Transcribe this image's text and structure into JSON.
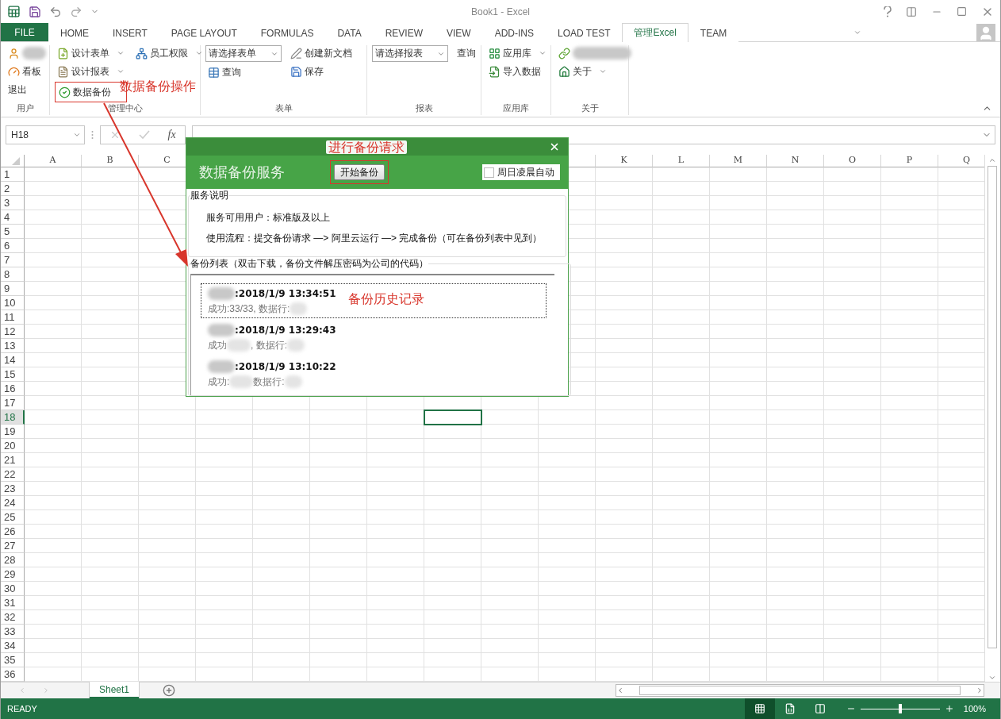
{
  "window": {
    "title": "Book1 - Excel"
  },
  "ribbon_tabs": [
    {
      "label": "FILE",
      "kind": "file",
      "selected": false
    },
    {
      "label": "HOME",
      "kind": "tab",
      "selected": false
    },
    {
      "label": "INSERT",
      "kind": "tab",
      "selected": false
    },
    {
      "label": "PAGE LAYOUT",
      "kind": "tab",
      "selected": false
    },
    {
      "label": "FORMULAS",
      "kind": "tab",
      "selected": false
    },
    {
      "label": "DATA",
      "kind": "tab",
      "selected": false
    },
    {
      "label": "REVIEW",
      "kind": "tab",
      "selected": false
    },
    {
      "label": "VIEW",
      "kind": "tab",
      "selected": false
    },
    {
      "label": "ADD-INS",
      "kind": "tab",
      "selected": false
    },
    {
      "label": "LOAD TEST",
      "kind": "tab",
      "selected": false
    },
    {
      "label": "管理Excel",
      "kind": "tab",
      "selected": true
    },
    {
      "label": "TEAM",
      "kind": "tab",
      "selected": false
    }
  ],
  "ribbon_groups": [
    {
      "label": "用户",
      "columns": [
        [
          {
            "kind": "user"
          },
          {
            "kind": "button",
            "label": "看板"
          },
          {
            "kind": "plain",
            "label": "退出"
          }
        ]
      ]
    },
    {
      "label": "管理中心",
      "columns": [
        [
          {
            "kind": "menu",
            "label": "设计表单"
          },
          {
            "kind": "menu",
            "label": "设计报表"
          },
          {
            "kind": "button",
            "label": "数据备份",
            "boxed": true
          }
        ],
        [
          {
            "kind": "menu",
            "label": "员工权限"
          }
        ]
      ]
    },
    {
      "label": "表单",
      "columns": [
        [
          {
            "kind": "select",
            "label": "请选择表单"
          },
          {
            "kind": "button",
            "label": "查询"
          }
        ],
        [
          {
            "kind": "button",
            "label": "创建新文档"
          },
          {
            "kind": "button",
            "label": "保存"
          }
        ]
      ]
    },
    {
      "label": "报表",
      "columns": [
        [
          {
            "kind": "select",
            "label": "请选择报表"
          }
        ],
        [
          {
            "kind": "plain",
            "label": "查询"
          }
        ]
      ]
    },
    {
      "label": "应用库",
      "columns": [
        [
          {
            "kind": "menu",
            "label": "应用库"
          },
          {
            "kind": "button",
            "label": "导入数据"
          }
        ]
      ]
    },
    {
      "label": "关于",
      "columns": [
        [
          {
            "kind": "user"
          },
          {
            "kind": "menu",
            "label": "关于"
          }
        ]
      ]
    }
  ],
  "formula_bar": {
    "name_box": "H18",
    "function_label": "fx"
  },
  "columns_left": [
    {
      "label": "A",
      "selected": false
    },
    {
      "label": "B",
      "selected": false
    },
    {
      "label": "C",
      "selected": false
    }
  ],
  "columns_right": [
    {
      "label": "K",
      "selected": false
    },
    {
      "label": "L",
      "selected": false
    },
    {
      "label": "M",
      "selected": false
    },
    {
      "label": "N",
      "selected": false
    },
    {
      "label": "O",
      "selected": false
    },
    {
      "label": "P",
      "selected": false
    },
    {
      "label": "Q",
      "selected": false
    }
  ],
  "rows": [
    {
      "label": "1",
      "selected": false
    },
    {
      "label": "2",
      "selected": false
    },
    {
      "label": "3",
      "selected": false
    },
    {
      "label": "4",
      "selected": false
    },
    {
      "label": "5",
      "selected": false
    },
    {
      "label": "6",
      "selected": false
    },
    {
      "label": "7",
      "selected": false
    },
    {
      "label": "8",
      "selected": false
    },
    {
      "label": "9",
      "selected": false
    },
    {
      "label": "10",
      "selected": false
    },
    {
      "label": "11",
      "selected": false
    },
    {
      "label": "12",
      "selected": false
    },
    {
      "label": "13",
      "selected": false
    },
    {
      "label": "14",
      "selected": false
    },
    {
      "label": "15",
      "selected": false
    },
    {
      "label": "16",
      "selected": false
    },
    {
      "label": "17",
      "selected": false
    },
    {
      "label": "18",
      "selected": true
    },
    {
      "label": "19",
      "selected": false
    },
    {
      "label": "20",
      "selected": false
    },
    {
      "label": "21",
      "selected": false
    },
    {
      "label": "22",
      "selected": false
    },
    {
      "label": "23",
      "selected": false
    },
    {
      "label": "24",
      "selected": false
    },
    {
      "label": "25",
      "selected": false
    },
    {
      "label": "26",
      "selected": false
    },
    {
      "label": "27",
      "selected": false
    },
    {
      "label": "28",
      "selected": false
    },
    {
      "label": "29",
      "selected": false
    },
    {
      "label": "30",
      "selected": false
    },
    {
      "label": "31",
      "selected": false
    },
    {
      "label": "32",
      "selected": false
    },
    {
      "label": "33",
      "selected": false
    },
    {
      "label": "34",
      "selected": false
    },
    {
      "label": "35",
      "selected": false
    },
    {
      "label": "36",
      "selected": false
    }
  ],
  "dialog": {
    "title": "数据备份服务",
    "start_button": {
      "label": "开始备份",
      "boxed": true
    },
    "auto_checkbox": {
      "label": "周日凌晨自动",
      "checked": false
    },
    "info": {
      "legend": "服务说明",
      "lines": [
        "服务可用用户：标准版及以上",
        "使用流程：提交备份请求  —> 阿里云运行  —> 完成备份（可在备份列表中见到）"
      ]
    },
    "backups": {
      "legend": "备份列表（双击下载，备份文件解压密码为公司的代码）",
      "entries": [
        {
          "time": ":2018/1/9 13:34:51",
          "detail_parts": [
            "成功:33/33, 数据行:"
          ],
          "selected": true
        },
        {
          "time": ":2018/1/9 13:29:43",
          "detail_parts": [
            "成功",
            ", 数据行:"
          ],
          "selected": false
        },
        {
          "time": ":2018/1/9 13:10:22",
          "detail_parts": [
            "成功:",
            "数据行:"
          ],
          "selected": false
        }
      ]
    }
  },
  "annotations": [
    {
      "text": "数据备份操作"
    },
    {
      "text": "进行备份请求"
    },
    {
      "text": "备份历史记录"
    }
  ],
  "sheet_tabs": [
    {
      "label": "Sheet1",
      "selected": true
    }
  ],
  "status_bar": {
    "status": "READY",
    "views": [
      {
        "kind": "normal",
        "selected": true
      },
      {
        "kind": "page-layout",
        "selected": false
      },
      {
        "kind": "page-break",
        "selected": false
      }
    ],
    "zoom": {
      "level": 0.5,
      "label": "100%"
    }
  }
}
